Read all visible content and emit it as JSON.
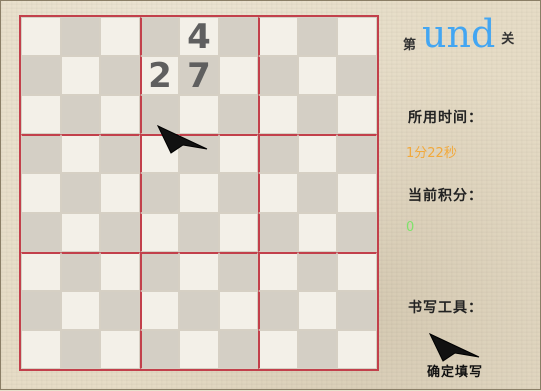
{
  "game": {
    "level": {
      "prefix": "第",
      "number": "und",
      "suffix": "关"
    },
    "time_label": "所用时间：",
    "time_value": "1分22秒",
    "score_label": "当前积分：",
    "score_value": "0",
    "tool_label": "书写工具：",
    "confirm_label": "确定填写",
    "colors": {
      "level_number": "#43a6f2",
      "time_value": "#f2a93b",
      "score_value": "#7ee36b",
      "grid_line": "#c2404b"
    }
  },
  "board": {
    "rows": [
      [
        "",
        "",
        "",
        "",
        "4",
        "",
        "",
        "",
        ""
      ],
      [
        "",
        "",
        "",
        "2",
        "7",
        "",
        "",
        "",
        ""
      ],
      [
        "",
        "",
        "",
        "",
        "",
        "",
        "",
        "",
        ""
      ],
      [
        "",
        "",
        "",
        "",
        "",
        "",
        "",
        "",
        ""
      ],
      [
        "",
        "",
        "",
        "",
        "",
        "",
        "",
        "",
        ""
      ],
      [
        "",
        "",
        "",
        "",
        "",
        "",
        "",
        "",
        ""
      ],
      [
        "",
        "",
        "",
        "",
        "",
        "",
        "",
        "",
        ""
      ],
      [
        "",
        "",
        "",
        "",
        "",
        "",
        "",
        "",
        ""
      ],
      [
        "",
        "",
        "",
        "",
        "",
        "",
        "",
        "",
        ""
      ]
    ]
  }
}
